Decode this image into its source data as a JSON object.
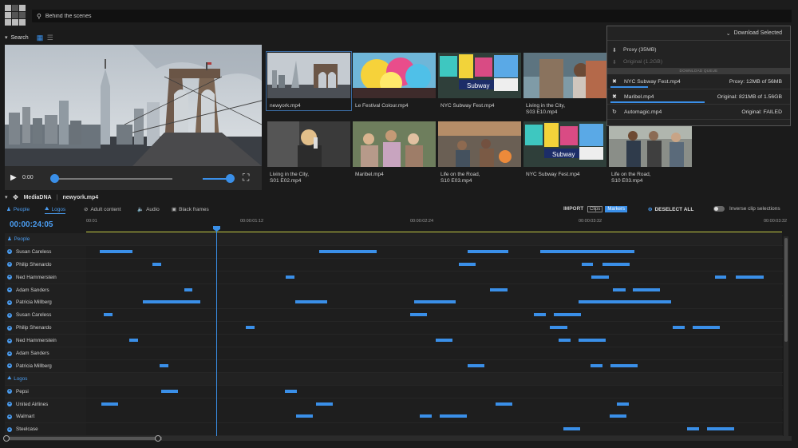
{
  "search": {
    "value": "Behind the scenes"
  },
  "search_section": {
    "label": "Search"
  },
  "player": {
    "time": "0:00",
    "progress": 0.0,
    "volume": 1.0
  },
  "thumbnails": [
    {
      "name": "newyork.mp4",
      "selected": true
    },
    {
      "name": "Le Festival Colour.mp4"
    },
    {
      "name": "NYC Subway Fest.mp4"
    },
    {
      "name": "Living in the City,\nS03 E10.mp4"
    },
    {
      "name": "Living in the City,\nS03 E10.mp4"
    },
    {
      "name": "Living in the City,\nS01 E02.mp4"
    },
    {
      "name": "Maribel.mp4"
    },
    {
      "name": "Life on the Road,\nS10 E03.mp4"
    },
    {
      "name": "NYC Subway Fest.mp4"
    },
    {
      "name": "Life on the Road,\nS10 E03.mp4"
    }
  ],
  "download": {
    "header": "Download Selected",
    "options": [
      {
        "label": "Proxy (35MB)",
        "enabled": true
      },
      {
        "label": "Original (1.2GB)",
        "enabled": false
      }
    ],
    "queue_label": "DOWNLOAD QUEUE",
    "queue": [
      {
        "icon": "close-icon",
        "name": "NYC Subway Fest.mp4",
        "status": "Proxy: 12MB of 56MB",
        "progress": 0.21
      },
      {
        "icon": "close-icon",
        "name": "Maribel.mp4",
        "status": "Original: 821MB of 1.56GB",
        "progress": 0.53
      },
      {
        "icon": "retry-icon",
        "name": "Automagic.mp4",
        "status": "Original: FAILED",
        "progress": 0
      }
    ]
  },
  "mediadna": {
    "title": "MediaDNA",
    "file": "newyork.mp4"
  },
  "toolbar": {
    "tabs": [
      "People",
      "Logos",
      "Adult content",
      "Audio",
      "Black frames"
    ],
    "import_label": "IMPORT",
    "clips_label": "Clips",
    "markers_label": "Markers",
    "deselect_label": "DESELECT ALL",
    "inverse_label": "Inverse clip selections"
  },
  "timeline": {
    "current_time": "00:00:24:05",
    "ticks": [
      "00:01",
      "00:00:01:12",
      "00:00:02:24",
      "00:00:03:32",
      "00:00:03:32"
    ],
    "playhead": 0.187,
    "rows": [
      {
        "type": "category",
        "label": "People",
        "segments": []
      },
      {
        "label": "Susan Careless",
        "segments": [
          [
            0.02,
            0.067
          ],
          [
            0.335,
            0.418
          ],
          [
            0.548,
            0.607
          ],
          [
            0.653,
            0.788
          ]
        ]
      },
      {
        "label": "Philip Shenardo",
        "segments": [
          [
            0.095,
            0.108
          ],
          [
            0.536,
            0.56
          ],
          [
            0.712,
            0.728
          ],
          [
            0.742,
            0.781
          ]
        ]
      },
      {
        "label": "Ned Hammerstein",
        "segments": [
          [
            0.287,
            0.3
          ],
          [
            0.726,
            0.751
          ],
          [
            0.904,
            0.92
          ],
          [
            0.933,
            0.973
          ]
        ]
      },
      {
        "label": "Adam Sanders",
        "segments": [
          [
            0.141,
            0.153
          ],
          [
            0.58,
            0.605
          ],
          [
            0.757,
            0.775
          ],
          [
            0.786,
            0.825
          ]
        ]
      },
      {
        "label": "Patricia Millberg",
        "segments": [
          [
            0.081,
            0.164
          ],
          [
            0.301,
            0.347
          ],
          [
            0.471,
            0.531
          ],
          [
            0.707,
            0.84
          ]
        ]
      },
      {
        "label": "Susan Careless",
        "segments": [
          [
            0.025,
            0.038
          ],
          [
            0.466,
            0.49
          ],
          [
            0.643,
            0.66
          ],
          [
            0.672,
            0.711
          ]
        ]
      },
      {
        "label": "Philip Shenardo",
        "segments": [
          [
            0.229,
            0.242
          ],
          [
            0.666,
            0.691
          ],
          [
            0.843,
            0.86
          ],
          [
            0.872,
            0.911
          ]
        ]
      },
      {
        "label": "Ned Hammerstein",
        "segments": [
          [
            0.062,
            0.075
          ],
          [
            0.502,
            0.526
          ],
          [
            0.679,
            0.696
          ],
          [
            0.708,
            0.747
          ]
        ]
      },
      {
        "label": "Adam Sanders",
        "segments": []
      },
      {
        "label": "Patricia Millberg",
        "segments": [
          [
            0.106,
            0.119
          ],
          [
            0.548,
            0.572
          ],
          [
            0.725,
            0.742
          ],
          [
            0.754,
            0.793
          ]
        ]
      },
      {
        "type": "category",
        "label": "Logos",
        "segments": []
      },
      {
        "label": "Pepsi",
        "segments": [
          [
            0.108,
            0.132
          ],
          [
            0.285,
            0.302
          ]
        ]
      },
      {
        "label": "United Airlines",
        "segments": [
          [
            0.022,
            0.046
          ],
          [
            0.33,
            0.354
          ],
          [
            0.588,
            0.612
          ],
          [
            0.763,
            0.78
          ]
        ]
      },
      {
        "label": "Walmart",
        "segments": [
          [
            0.302,
            0.326
          ],
          [
            0.479,
            0.496
          ],
          [
            0.508,
            0.547
          ],
          [
            0.752,
            0.776
          ]
        ]
      },
      {
        "label": "Steelcase",
        "segments": [
          [
            0.686,
            0.71
          ],
          [
            0.863,
            0.88
          ],
          [
            0.892,
            0.931
          ]
        ]
      }
    ]
  }
}
